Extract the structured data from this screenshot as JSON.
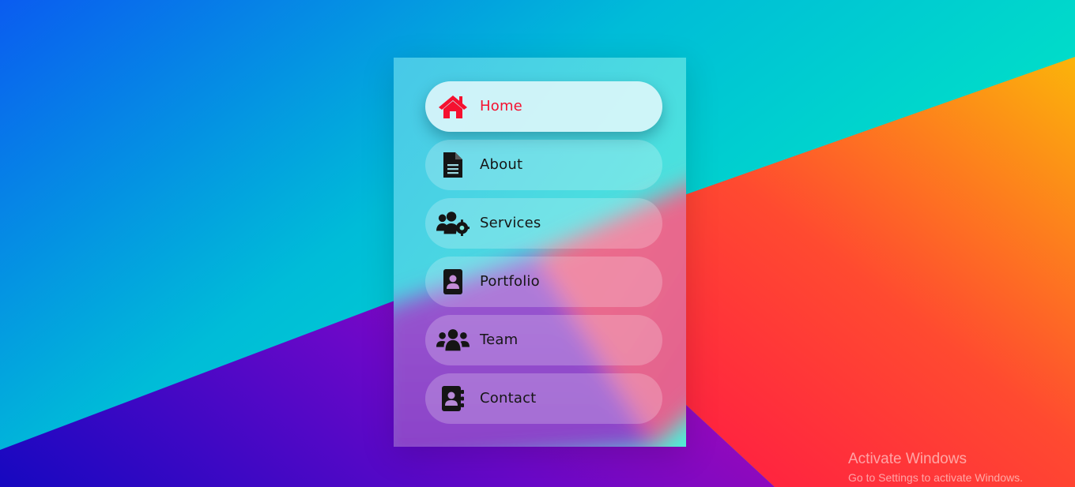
{
  "nav": {
    "items": [
      {
        "label": "Home",
        "icon": "home-icon",
        "active": true
      },
      {
        "label": "About",
        "icon": "document-icon",
        "active": false
      },
      {
        "label": "Services",
        "icon": "users-gear-icon",
        "active": false
      },
      {
        "label": "Portfolio",
        "icon": "portrait-icon",
        "active": false
      },
      {
        "label": "Team",
        "icon": "team-icon",
        "active": false
      },
      {
        "label": "Contact",
        "icon": "address-book-icon",
        "active": false
      }
    ]
  },
  "watermark": {
    "title": "Activate Windows",
    "subtitle": "Go to Settings to activate Windows."
  },
  "colors": {
    "active_text": "#f5102f",
    "text": "#161616",
    "bg_blue": "#0a5cf0",
    "bg_cyan": "#00e8c8",
    "bg_orange": "#ff5a2a",
    "bg_purple": "#5a0bd0"
  }
}
